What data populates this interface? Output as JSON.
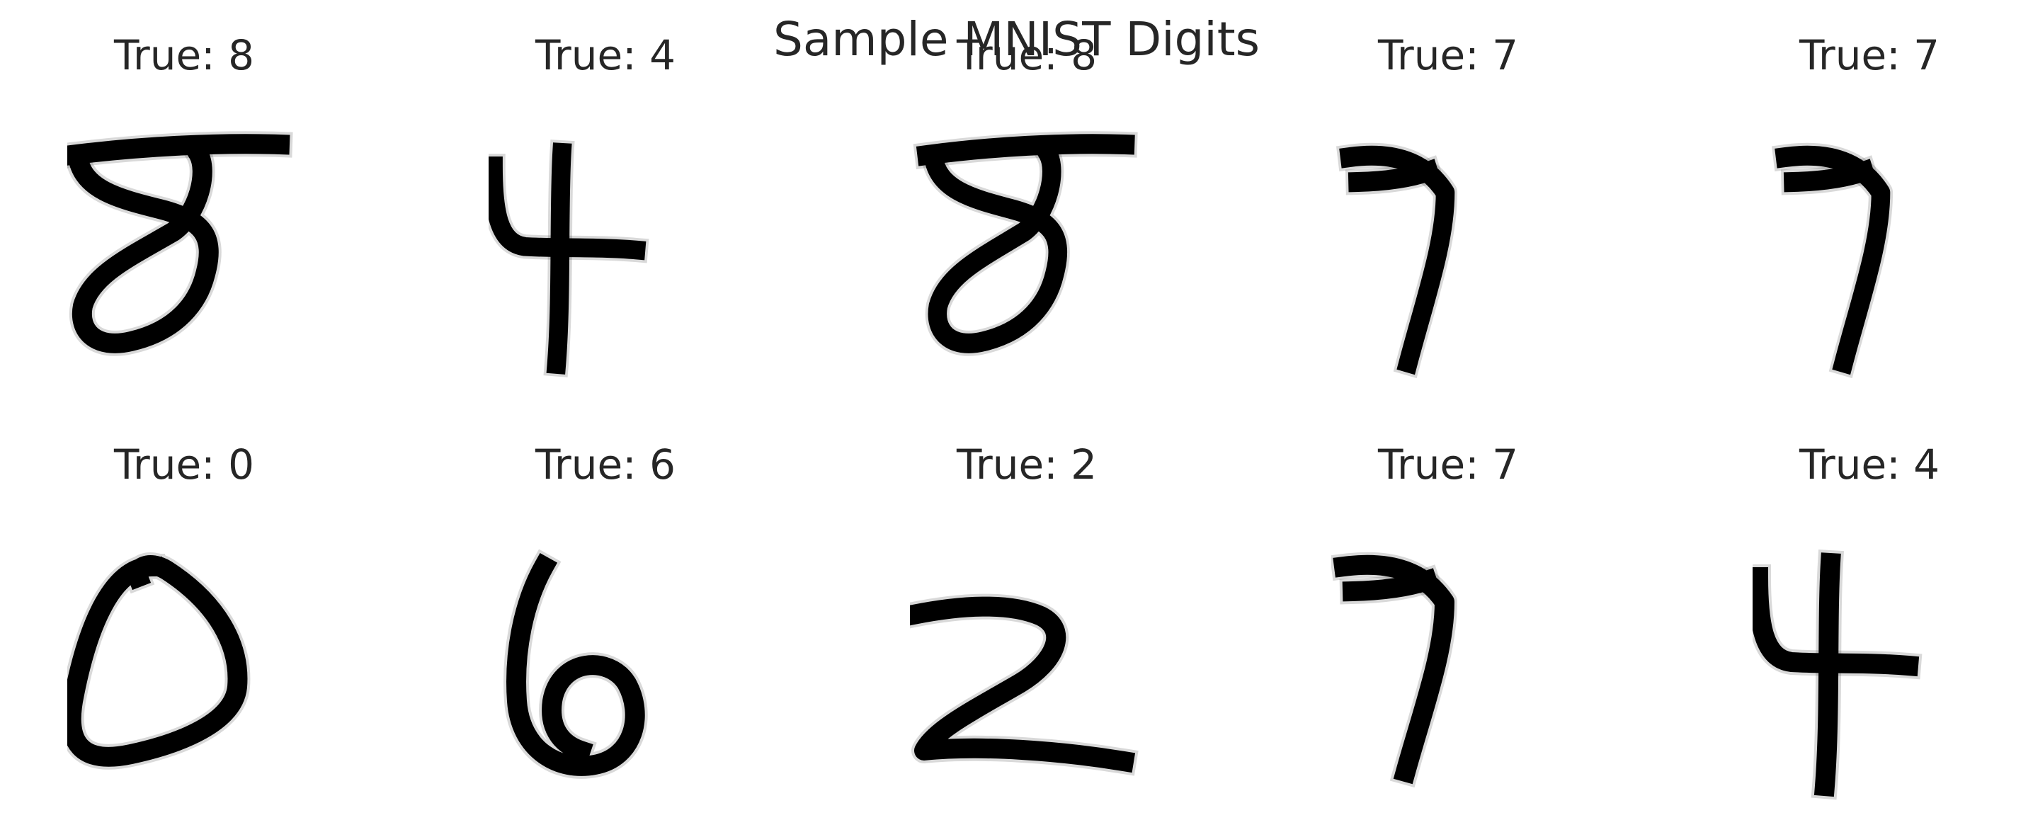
{
  "figure": {
    "title": "Sample MNIST Digits"
  },
  "panels": [
    {
      "label": "True: 8",
      "digit": "8"
    },
    {
      "label": "True: 4",
      "digit": "4"
    },
    {
      "label": "True: 8",
      "digit": "8"
    },
    {
      "label": "True: 7",
      "digit": "7"
    },
    {
      "label": "True: 7",
      "digit": "7"
    },
    {
      "label": "True: 0",
      "digit": "0"
    },
    {
      "label": "True: 6",
      "digit": "6"
    },
    {
      "label": "True: 2",
      "digit": "2"
    },
    {
      "label": "True: 7",
      "digit": "7"
    },
    {
      "label": "True: 4",
      "digit": "4"
    }
  ],
  "colors": {
    "text": "#262626",
    "background": "#ffffff",
    "digit_ink": "#000000"
  }
}
